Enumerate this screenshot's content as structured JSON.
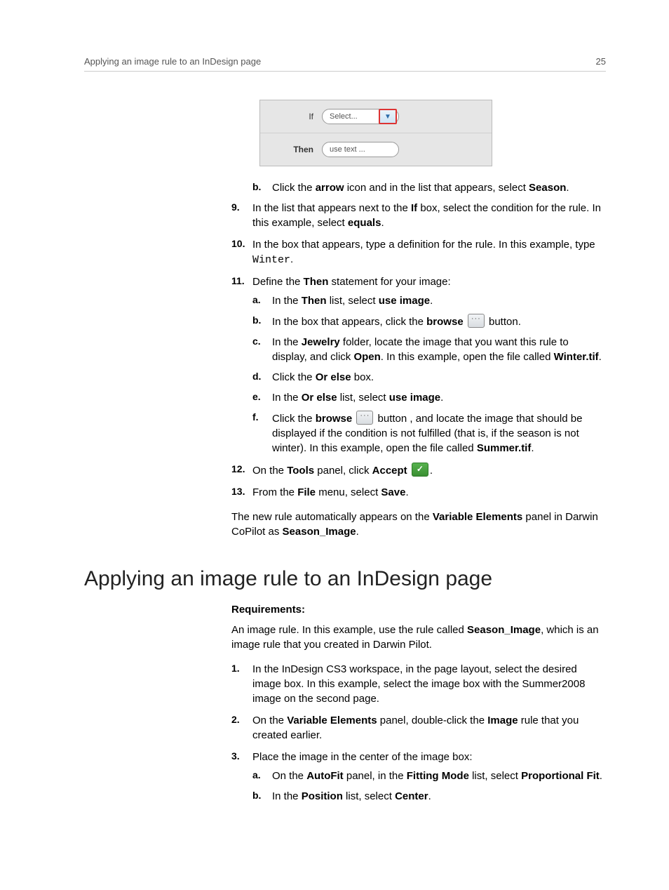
{
  "header": {
    "title": "Applying an image rule to an InDesign page",
    "page_number": "25"
  },
  "figure": {
    "if_label": "If",
    "then_label": "Then",
    "select_placeholder": "Select...",
    "use_text_placeholder": "use text  ..."
  },
  "steps_top": {
    "b_prefix": "b.",
    "b_text_1": "Click the ",
    "b_bold_1": "arrow",
    "b_text_2": " icon and in the list that appears, select ",
    "b_bold_2": "Season",
    "b_text_3": ".",
    "nine_num": "9.",
    "nine_text_1": "In the list that appears next to the ",
    "nine_bold_1": "If",
    "nine_text_2": " box, select the condition for the rule. In this example, select ",
    "nine_bold_2": "equals",
    "nine_text_3": ".",
    "ten_num": "10.",
    "ten_text_1": "In the box that appears, type a definition for the rule. In this example, type ",
    "ten_mono": "Winter",
    "ten_text_2": ".",
    "eleven_num": "11.",
    "eleven_text_1": "Define the ",
    "eleven_bold_1": "Then",
    "eleven_text_2": " statement for your image:",
    "eleven_a_letter": "a.",
    "eleven_a_text_1": "In the ",
    "eleven_a_bold_1": "Then",
    "eleven_a_text_2": " list, select ",
    "eleven_a_bold_2": "use image",
    "eleven_a_text_3": ".",
    "eleven_b_letter": "b.",
    "eleven_b_text_1": "In the box that appears, click the ",
    "eleven_b_bold_1": "browse",
    "eleven_b_text_2": " button.",
    "eleven_c_letter": "c.",
    "eleven_c_text_1": "In the ",
    "eleven_c_bold_1": "Jewelry",
    "eleven_c_text_2": " folder, locate the image that you want this rule to display, and click ",
    "eleven_c_bold_2": "Open",
    "eleven_c_text_3": ". In this example, open the file called ",
    "eleven_c_bold_3": "Winter.tif",
    "eleven_c_text_4": ".",
    "eleven_d_letter": "d.",
    "eleven_d_text_1": "Click the ",
    "eleven_d_bold_1": "Or else",
    "eleven_d_text_2": " box.",
    "eleven_e_letter": "e.",
    "eleven_e_text_1": "In the ",
    "eleven_e_bold_1": "Or else",
    "eleven_e_text_2": " list, select ",
    "eleven_e_bold_2": "use image",
    "eleven_e_text_3": ".",
    "eleven_f_letter": "f.",
    "eleven_f_text_1": "Click the ",
    "eleven_f_bold_1": "browse",
    "eleven_f_text_2": " button , and locate the image that should be displayed if the condition is not fulfilled (that is, if the season is not winter). In this example, open the file called ",
    "eleven_f_bold_2": "Summer.tif",
    "eleven_f_text_3": ".",
    "twelve_num": "12.",
    "twelve_text_1": "On the ",
    "twelve_bold_1": "Tools",
    "twelve_text_2": " panel, click ",
    "twelve_bold_2": "Accept",
    "twelve_text_3": ".",
    "thirteen_num": "13.",
    "thirteen_text_1": "From the ",
    "thirteen_bold_1": "File",
    "thirteen_text_2": " menu, select ",
    "thirteen_bold_2": "Save",
    "thirteen_text_3": ".",
    "footer_1": "The new rule automatically appears on the ",
    "footer_bold_1": "Variable Elements",
    "footer_2": " panel in Darwin CoPilot as ",
    "footer_bold_2": "Season_Image",
    "footer_3": "."
  },
  "section2": {
    "heading": "Applying an image rule to an InDesign page",
    "requirements_label": "Requirements:",
    "req_text_1": "An image rule. In this example, use the rule called ",
    "req_bold_1": "Season_Image",
    "req_text_2": ", which is an image rule that you created in Darwin Pilot.",
    "one_num": "1.",
    "one_text": "In the InDesign CS3 workspace, in the page layout, select the desired image box. In this example, select the image box with the Summer2008 image on the second page.",
    "two_num": "2.",
    "two_text_1": "On the ",
    "two_bold_1": "Variable Elements",
    "two_text_2": " panel, double-click the ",
    "two_bold_2": "Image",
    "two_text_3": " rule that you created earlier.",
    "three_num": "3.",
    "three_text": "Place the image in the center of the image box:",
    "three_a_letter": "a.",
    "three_a_text_1": "On the ",
    "three_a_bold_1": "AutoFit",
    "three_a_text_2": " panel, in the ",
    "three_a_bold_2": "Fitting Mode",
    "three_a_text_3": " list, select ",
    "three_a_bold_3": "Proportional Fit",
    "three_a_text_4": ".",
    "three_b_letter": "b.",
    "three_b_text_1": "In the ",
    "three_b_bold_1": "Position",
    "three_b_text_2": " list, select ",
    "three_b_bold_2": "Center",
    "three_b_text_3": "."
  }
}
